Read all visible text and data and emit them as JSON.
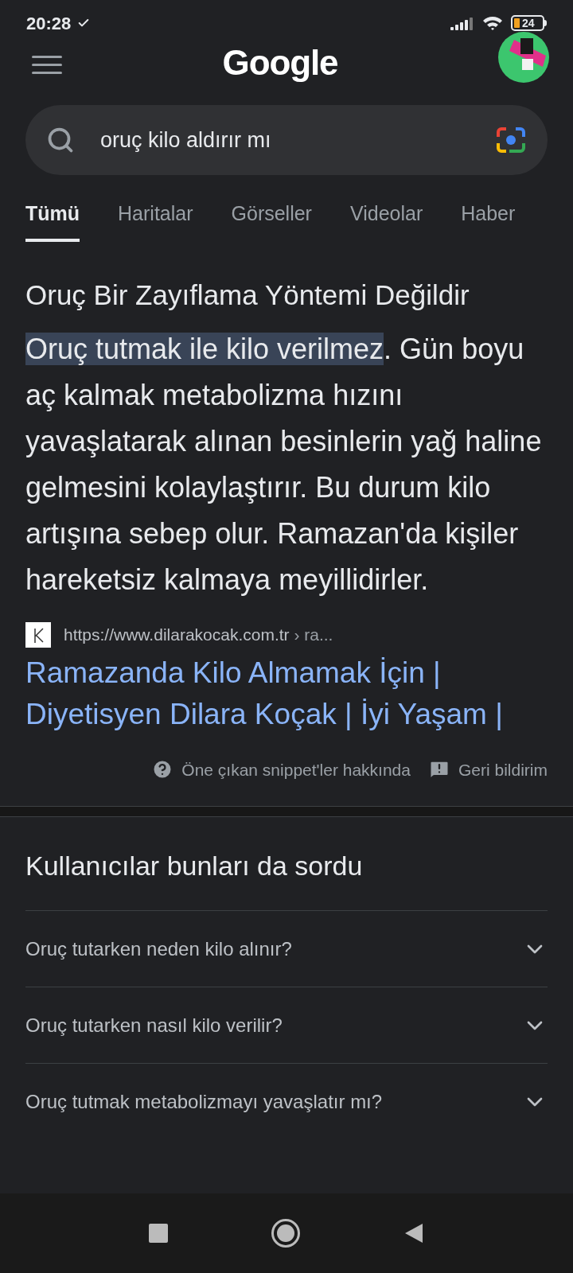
{
  "status_bar": {
    "time": "20:28",
    "battery": "24"
  },
  "header": {
    "logo": "Google"
  },
  "search": {
    "value": "oruç kilo aldırır mı"
  },
  "tabs": [
    {
      "label": "Tümü",
      "selected": true
    },
    {
      "label": "Haritalar",
      "selected": false
    },
    {
      "label": "Görseller",
      "selected": false
    },
    {
      "label": "Videolar",
      "selected": false
    },
    {
      "label": "Haber",
      "selected": false
    }
  ],
  "snippet": {
    "title": "Oruç Bir Zayıflama Yöntemi Değildir",
    "highlight": "Oruç tutmak ile kilo verilmez",
    "text": ". Gün boyu aç kalmak metabolizma hızını yavaşlatarak alınan besinlerin yağ haline gelmesini kolaylaştırır. Bu durum kilo artışına sebep olur. Ramazan'da kişiler hareketsiz kalmaya meyillidirler.",
    "source_url": "https://www.dilarakocak.com.tr",
    "source_path": "› ra...",
    "link_title": "Ramazanda Kilo Almamak İçin | Diyetisyen Dilara Koçak | İyi Yaşam |",
    "about": "Öne çıkan snippet'ler hakkında",
    "feedback": "Geri bildirim"
  },
  "related_questions": {
    "title": "Kullanıcılar bunları da sordu",
    "items": [
      {
        "question": "Oruç tutarken neden kilo alınır?",
        "expanded": false
      },
      {
        "question": "Oruç tutarken nasıl kilo verilir?",
        "expanded": false
      },
      {
        "question": "Oruç tutmak metabolizmayı yavaşlatır mı?",
        "expanded": false
      }
    ]
  }
}
